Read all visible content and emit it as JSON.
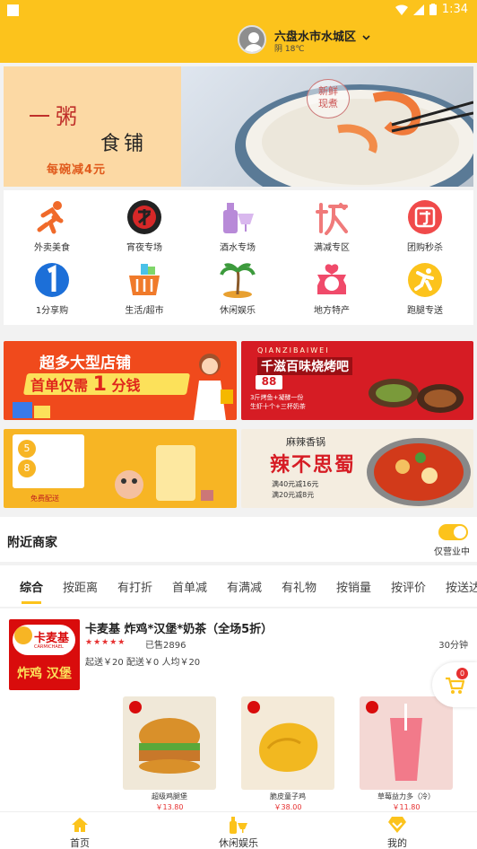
{
  "status": {
    "time": "1:34"
  },
  "header": {
    "location": "六盘水市水城区",
    "weather": "阴 18℃"
  },
  "banner": {
    "title_line1": "一粥",
    "title_line2": "食铺",
    "promo": "每碗减4元",
    "tag_line1": "新鲜",
    "tag_line2": "现煮"
  },
  "categories": [
    {
      "label": "外卖美食",
      "icon": "runner-icon"
    },
    {
      "label": "宵夜专场",
      "icon": "night-icon"
    },
    {
      "label": "酒水专场",
      "icon": "drinks-icon"
    },
    {
      "label": "满减专区",
      "icon": "discount-icon"
    },
    {
      "label": "团购秒杀",
      "icon": "group-buy-icon"
    },
    {
      "label": "1分享购",
      "icon": "one-cent-icon"
    },
    {
      "label": "生活/超市",
      "icon": "basket-icon"
    },
    {
      "label": "休闲娱乐",
      "icon": "palm-icon"
    },
    {
      "label": "地方特产",
      "icon": "gift-icon"
    },
    {
      "label": "跑腿专送",
      "icon": "errand-icon"
    }
  ],
  "promos": {
    "p1_line1": "超多大型店铺",
    "p1_line2a": "首单仅需",
    "p1_num": "1",
    "p1_line2b": "分钱",
    "p2_brand": "QIANZIBAIWEI",
    "p2_title": "千滋百味烧烤吧",
    "p2_price": "88",
    "p2_line1": "3斤烤鱼+凝酵一份",
    "p2_line2": "生虾十个+三杯奶茶",
    "p3_badge1": "5",
    "p3_badge2": "8",
    "p3_line": "免费配送",
    "p4_title": "辣不思蜀",
    "p4_sub": "麻辣香锅",
    "p4_line1": "满40元减16元",
    "p4_line2": "满20元减8元"
  },
  "nearby": {
    "title": "附近商家",
    "toggle_label": "仅营业中"
  },
  "tabs": [
    "综合",
    "按距离",
    "有打折",
    "首单减",
    "有满减",
    "有礼物",
    "按销量",
    "按评价",
    "按送达"
  ],
  "shop": {
    "name": "卡麦基 炸鸡*汉堡*奶茶（全场5折）",
    "logo_line1": "卡麦基",
    "logo_line2": "CARMICHAEL",
    "logo_line3": "炸鸡 汉堡",
    "stars": "★★★★★",
    "sold": "已售2896",
    "time": "30分钟",
    "fees": "起送￥20  配送￥0  人均￥20",
    "products": [
      {
        "name": "超级鸡腿堡",
        "price": "￥13.80"
      },
      {
        "name": "脆皮童子鸡",
        "price": "￥38.00"
      },
      {
        "name": "草莓益力多（冷）",
        "price": "￥11.80"
      }
    ]
  },
  "cart": {
    "count": "0"
  },
  "bottomnav": [
    {
      "label": "首页"
    },
    {
      "label": "休闲娱乐"
    },
    {
      "label": "我的"
    }
  ],
  "colors": {
    "accent": "#fcc31c",
    "price": "#e63030"
  }
}
